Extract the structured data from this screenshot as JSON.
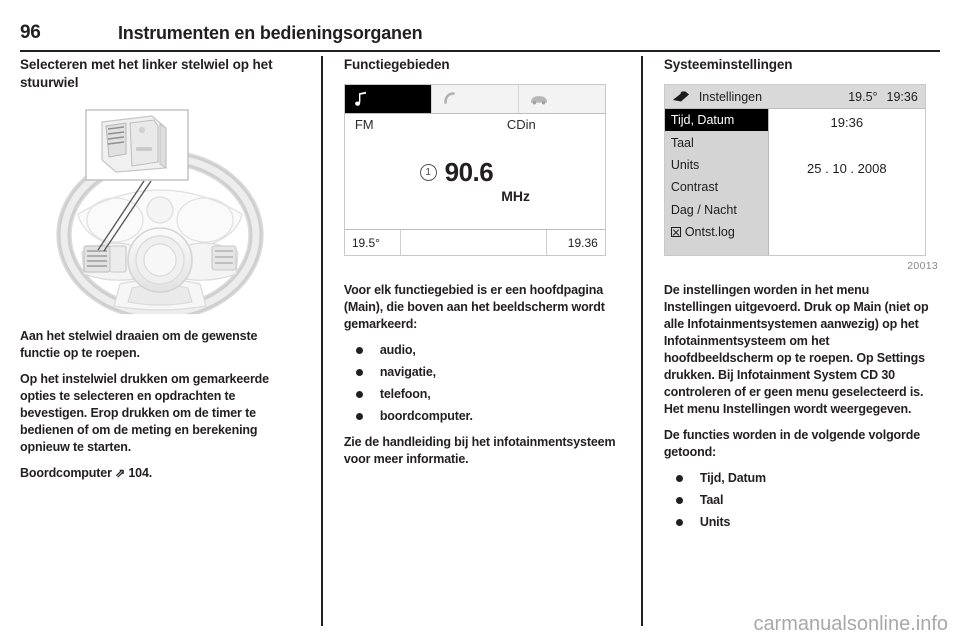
{
  "header": {
    "page_number": "96",
    "title": "Instrumenten en bedieningsorganen"
  },
  "left_column": {
    "heading": "Selecteren met het linker stelwiel op het stuurwiel",
    "figure_name": "steering-wheel-with-left-thumbwheel",
    "paragraphs": [
      "Aan het stelwiel draaien om de gewenste functie op te roepen.",
      "Op het instelwiel drukken om gemarkeerde opties te selecteren en opdrachten te bevestigen. Erop drukken om de timer te bedienen of om de meting en berekening opnieuw te starten."
    ],
    "reference": {
      "label": "Boordcomputer",
      "arrow": "⇗",
      "page": "104."
    }
  },
  "middle_column": {
    "heading": "Functiegebieden",
    "radio_screen": {
      "tabs": [
        {
          "icon": "music-note-icon",
          "active": true
        },
        {
          "icon": "phone-handset-icon",
          "active": false
        },
        {
          "icon": "car-icon",
          "active": false
        }
      ],
      "band_label": "FM",
      "source_label": "CDin",
      "preset_number": "1",
      "frequency": "90.6",
      "frequency_unit": "MHz",
      "status_temperature": "19.5°",
      "status_clock": "19.36"
    },
    "paragraphs": [
      "Voor elk functiegebied is er een hoofdpagina (Main), die boven aan het beeldscherm wordt gemarkeerd:"
    ],
    "bullets": [
      "audio,",
      "navigatie,",
      "telefoon,",
      "boordcomputer."
    ],
    "closing": "Zie de handleiding bij het infotainmentsysteem voor meer informatie."
  },
  "right_column": {
    "heading": "Systeeminstellingen",
    "settings_screen": {
      "header_icon": "settings-wrench-icon",
      "header_title": "Instellingen",
      "header_temperature": "19.5°",
      "header_clock": "19:36",
      "menu_items": [
        {
          "label": "Tijd, Datum",
          "selected": true,
          "icon": null
        },
        {
          "label": "Taal",
          "selected": false,
          "icon": null
        },
        {
          "label": "Units",
          "selected": false,
          "icon": null
        },
        {
          "label": "Contrast",
          "selected": false,
          "icon": null
        },
        {
          "label": "Dag / Nacht",
          "selected": false,
          "icon": null
        },
        {
          "label": "Ontst.log",
          "selected": false,
          "icon": "crossed-box-icon"
        }
      ],
      "value_time": "19:36",
      "value_date": "25 . 10 . 2008",
      "figure_id": "20013"
    },
    "paragraphs": [
      "De instellingen worden in het menu Instellingen uitgevoerd. Druk op Main (niet op alle Infotainmentsystemen aanwezig) op het Infotainmentsysteem om het hoofdbeeldscherm op te roepen. Op Settings drukken. Bij Infotainment System CD 30 controleren of er geen menu geselecteerd is. Het menu Instellingen wordt weergegeven.",
      "De functies worden in de volgende volgorde getoond:"
    ],
    "bullets": [
      "Tijd, Datum",
      "Taal",
      "Units"
    ]
  },
  "watermark": "carmanualsonline.info",
  "colors": {
    "ink": "#231f20",
    "screen_grey": "#d4d4d4",
    "selected_bg": "#000000"
  }
}
